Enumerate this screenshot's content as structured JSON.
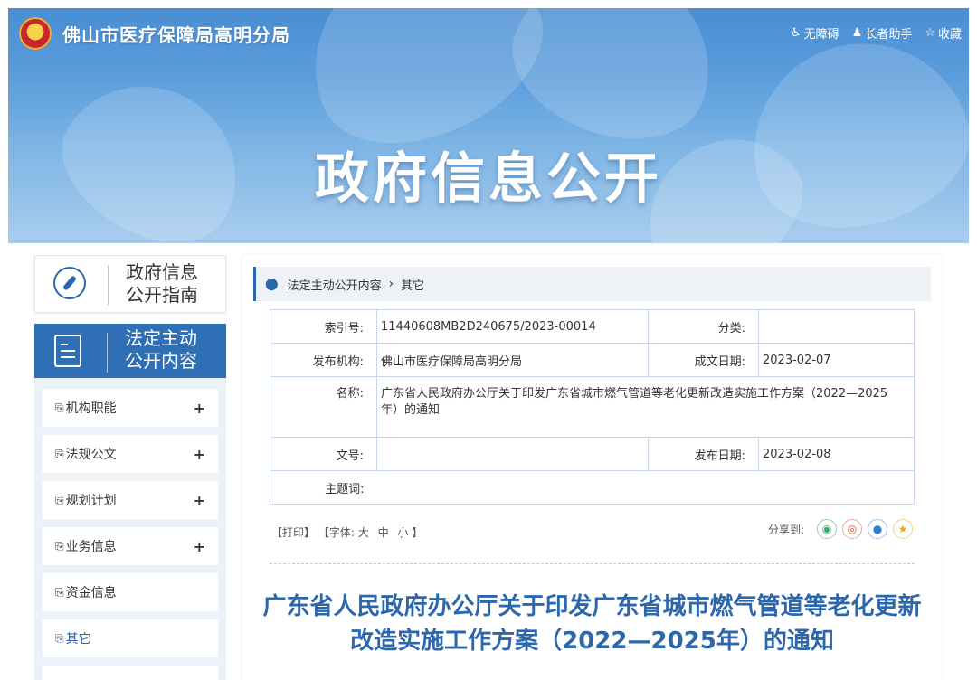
{
  "header": {
    "site_title": "佛山市医疗保障局高明分局",
    "links": [
      {
        "icon": "accessibility-icon",
        "glyph": "♿",
        "label": "无障碍"
      },
      {
        "icon": "elderly-helper-icon",
        "glyph": "♟",
        "label": "长者助手"
      },
      {
        "icon": "star-outline-icon",
        "glyph": "☆",
        "label": "收藏"
      }
    ],
    "banner_heading": "政府信息公开"
  },
  "sidebar": {
    "guide": {
      "line1": "政府信息",
      "line2": "公开指南"
    },
    "legal": {
      "line1": "法定主动",
      "line2": "公开内容"
    },
    "items": [
      {
        "label": "机构职能",
        "expand": "+"
      },
      {
        "label": "法规公文",
        "expand": "+"
      },
      {
        "label": "规划计划",
        "expand": "+"
      },
      {
        "label": "业务信息",
        "expand": "+"
      },
      {
        "label": "资金信息",
        "expand": ""
      },
      {
        "label": "其它",
        "expand": ""
      }
    ]
  },
  "breadcrumb": {
    "level1": "法定主动公开内容",
    "separator": "›",
    "level2": "其它"
  },
  "meta": {
    "index_label": "索引号:",
    "index_value": "11440608MB2D240675/2023-00014",
    "category_label": "分类:",
    "category_value": "",
    "publisher_label": "发布机构:",
    "publisher_value": "佛山市医疗保障局高明分局",
    "created_label": "成文日期:",
    "created_value": "2023-02-07",
    "name_label": "名称:",
    "name_value": "广东省人民政府办公厅关于印发广东省城市燃气管道等老化更新改造实施工作方案（2022—2025年）的通知",
    "docno_label": "文号:",
    "docno_value": "",
    "published_label": "发布日期:",
    "published_value": "2023-02-08",
    "subject_label": "主题词:",
    "subject_value": ""
  },
  "tools": {
    "print": "【打印】",
    "font_prefix": "【字体:",
    "large": "大",
    "medium": "中",
    "small": "小",
    "font_suffix": "】"
  },
  "share": {
    "label": "分享到:",
    "targets": [
      "wechat",
      "weibo",
      "qq",
      "qzone"
    ]
  },
  "document": {
    "title": "广东省人民政府办公厅关于印发广东省城市燃气管道等老化更新改造实施工作方案（2022—2025年）的通知"
  },
  "colors": {
    "accent": "#2c67ad",
    "banner": "#5b9ddc",
    "sidebar_active": "#2e6fb5"
  }
}
